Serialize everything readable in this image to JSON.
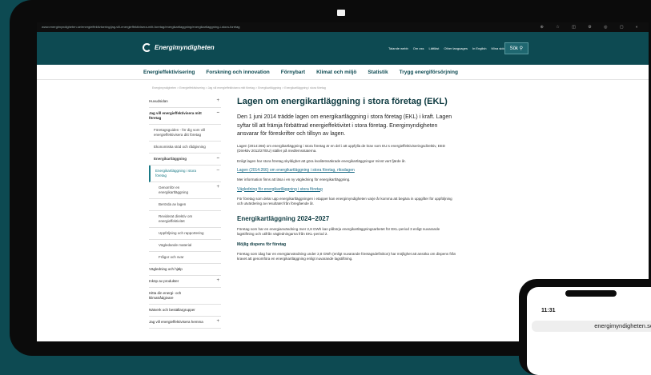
{
  "browser": {
    "url": "www.energimyndigheten.se/energieffektivisering/jag-vill-energieffektivisera-mitt-foretag/energikartlaggning/energikartlaggning-i-stora-foretag"
  },
  "header": {
    "logo_text": "Energimyndigheten",
    "links": [
      "Talande webb",
      "Om oss",
      "Lättläst",
      "Other languages",
      "In English",
      "Mina sidor"
    ],
    "search_label": "Sök"
  },
  "nav": {
    "items": [
      "Energieffektivisering",
      "Forskning och innovation",
      "Förnybart",
      "Klimat och miljö",
      "Statistik",
      "Trygg energiförsörjning"
    ]
  },
  "breadcrumb": "Energimyndigheten > Energieffektivisering > Jag vill energieffektivisera mitt företag > Energikartläggning > Energikartläggning i stora företag",
  "sidebar": {
    "items": [
      {
        "label": "Huvudsidan",
        "toggle": "+"
      },
      {
        "label": "Jag vill energieffektivisera mitt företag",
        "toggle": "–"
      },
      {
        "label": "Företagsguiden - för dig som vill energieffektivisera ditt företag",
        "toggle": ""
      },
      {
        "label": "Ekonomiska stöd och rådgivning",
        "toggle": ""
      },
      {
        "label": "Energikartläggning",
        "toggle": "–"
      },
      {
        "label": "Energikartläggning i stora företag",
        "toggle": "–"
      },
      {
        "label": "Genomför en energikartläggning",
        "toggle": "+"
      },
      {
        "label": "Berörda av lagen",
        "toggle": ""
      },
      {
        "label": "Reviderat direktiv om energieffektivitet",
        "toggle": ""
      },
      {
        "label": "Uppföljning och rapportering",
        "toggle": ""
      },
      {
        "label": "Vägledande material",
        "toggle": ""
      },
      {
        "label": "Frågor och svar",
        "toggle": ""
      },
      {
        "label": "Vägledning och hjälp",
        "toggle": ""
      },
      {
        "label": "Inköp av produkter",
        "toggle": "+"
      },
      {
        "label": "Hitta din energi- och klimatrådgivare",
        "toggle": ""
      },
      {
        "label": "Nätverk och beställargrupper",
        "toggle": ""
      },
      {
        "label": "Jag vill energieffektivisera hemma",
        "toggle": "+"
      }
    ]
  },
  "article": {
    "title": "Lagen om energikartläggning i stora företag (EKL)",
    "lead": "Den 1 juni 2014 trädde lagen om energikartläggning i stora företag (EKL) i kraft. Lagen syftar till att främja förbättrad energieffektivitet i stora företag. Energimyndigheten ansvarar för föreskrifter och tillsyn av lagen.",
    "p1": "Lagen (2014:266) om energikartläggning i stora företag är en del i att uppfylla de krav som EU:s energieffektiviseringsdirektiv, EED (Direktiv 2012/27/EU) ställer på medlemsstaterna.",
    "p2": "Enligt lagen har stora företag skyldighet att göra kvalitetssäkrade energikartläggningar minst vart fjärde år.",
    "link1": "Lagen (2014:266) om energikartläggning i stora företag, riksdagen",
    "p3": "Mer information finns att läsa i en ny vägledning för energikartläggning.",
    "link2": "Vägledning för energikartläggning i stora företag",
    "p4": "För företag som delar upp energikartläggningen i etapper kan energimyndigheten varje år komma att begära in uppgifter för uppföljning och utvärdering av resultatet från föregående år.",
    "h2": "Energikartläggning 2024–2027",
    "p5": "Företag som har en energianvändning över 2,8 GWh kan påbörja energikartläggningsarbetet för EKL-period 3 enligt nuvarande lagstiftning och utifrån vägledningarna från EKL-period 2.",
    "h3": "Möjlig dispens för företag",
    "p6": "Företag som idag har en energianvändning under 2,8 GWh (enligt nuvarande företagsdefinition) har möjlighet att ansöka om dispens från kravet att genomföra en energikartläggning enligt nuvarande lagstiftning."
  },
  "phone": {
    "time": "11:31",
    "url": "energimyndigheten.se"
  }
}
